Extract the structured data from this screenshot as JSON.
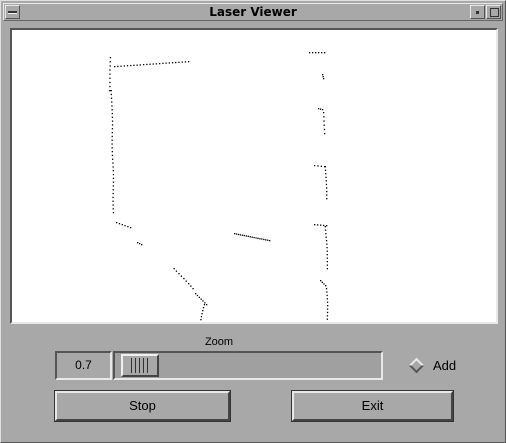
{
  "window": {
    "title": "Laser Viewer"
  },
  "titlebar_icons": {
    "menu": "window-menu-icon",
    "minimize": "minimize-icon",
    "maximize": "maximize-icon"
  },
  "zoom": {
    "label": "Zoom",
    "value": "0.7",
    "slider_fraction": 0.02
  },
  "add_toggle": {
    "label": "Add",
    "checked": false
  },
  "buttons": {
    "stop_label": "Stop",
    "exit_label": "Exit"
  },
  "colors": {
    "background": "#a8a8a8",
    "viewer_background": "#ffffff",
    "scan_points": "#000000"
  }
}
